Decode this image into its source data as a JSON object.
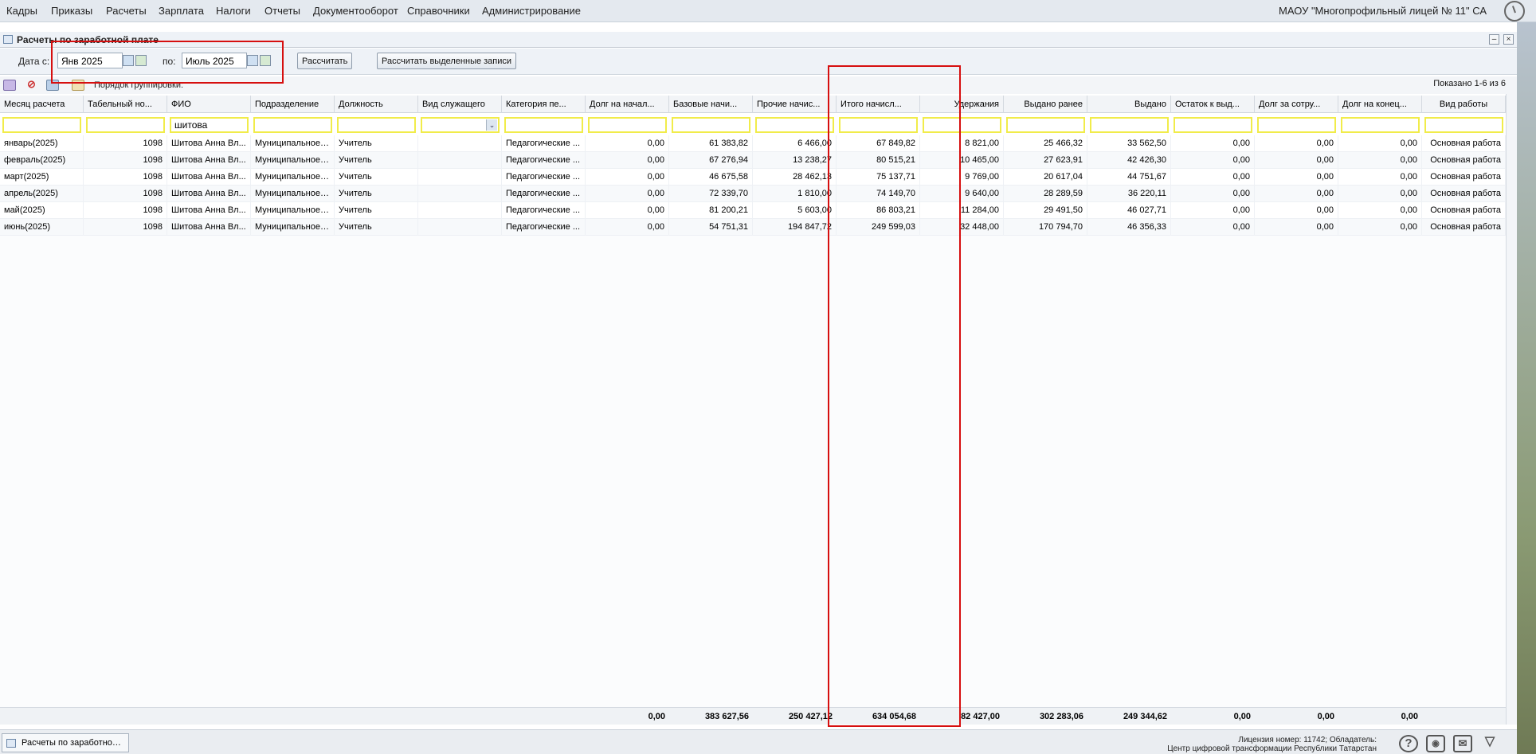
{
  "menu": [
    "Кадры",
    "Приказы",
    "Расчеты",
    "Зарплата",
    "Налоги",
    "Отчеты",
    "Документооборот",
    "Справочники",
    "Администрирование"
  ],
  "org_name": "МАОУ \"Многопрофильный лицей № 11\" СА",
  "window": {
    "title": "Расчеты по заработной плате"
  },
  "toolbar": {
    "date_from_label": "Дата с:",
    "date_from": "Янв 2025",
    "date_to_label": "по:",
    "date_to": "Июль 2025",
    "calc_button": "Рассчитать",
    "calc_selected_button": "Рассчитать выделенные записи"
  },
  "grid_toolbar": {
    "grouping_label": "Порядок группировки:",
    "shown": "Показано 1-6 из 6"
  },
  "columns": [
    "Месяц расчета",
    "Табельный но...",
    "ФИО",
    "Подразделение",
    "Должность",
    "Вид служащего",
    "Категория пе...",
    "Долг на начал...",
    "Базовые начи...",
    "Прочие начис...",
    "Итого начисл...",
    "Удержания",
    "Выдано ранее",
    "Выдано",
    "Остаток к выд...",
    "Долг за сотру...",
    "Долг на конец...",
    "Вид работы"
  ],
  "filters": {
    "fio": "шитова"
  },
  "rows": [
    [
      "январь(2025)",
      "1098",
      "Шитова Анна Вл...",
      "Муниципальное ...",
      "Учитель",
      "",
      "Педагогические ...",
      "0,00",
      "61 383,82",
      "6 466,00",
      "67 849,82",
      "8 821,00",
      "25 466,32",
      "33 562,50",
      "0,00",
      "0,00",
      "0,00",
      "Основная работа"
    ],
    [
      "февраль(2025)",
      "1098",
      "Шитова Анна Вл...",
      "Муниципальное ...",
      "Учитель",
      "",
      "Педагогические ...",
      "0,00",
      "67 276,94",
      "13 238,27",
      "80 515,21",
      "10 465,00",
      "27 623,91",
      "42 426,30",
      "0,00",
      "0,00",
      "0,00",
      "Основная работа"
    ],
    [
      "март(2025)",
      "1098",
      "Шитова Анна Вл...",
      "Муниципальное ...",
      "Учитель",
      "",
      "Педагогические ...",
      "0,00",
      "46 675,58",
      "28 462,13",
      "75 137,71",
      "9 769,00",
      "20 617,04",
      "44 751,67",
      "0,00",
      "0,00",
      "0,00",
      "Основная работа"
    ],
    [
      "апрель(2025)",
      "1098",
      "Шитова Анна Вл...",
      "Муниципальное ...",
      "Учитель",
      "",
      "Педагогические ...",
      "0,00",
      "72 339,70",
      "1 810,00",
      "74 149,70",
      "9 640,00",
      "28 289,59",
      "36 220,11",
      "0,00",
      "0,00",
      "0,00",
      "Основная работа"
    ],
    [
      "май(2025)",
      "1098",
      "Шитова Анна Вл...",
      "Муниципальное ...",
      "Учитель",
      "",
      "Педагогические ...",
      "0,00",
      "81 200,21",
      "5 603,00",
      "86 803,21",
      "11 284,00",
      "29 491,50",
      "46 027,71",
      "0,00",
      "0,00",
      "0,00",
      "Основная работа"
    ],
    [
      "июнь(2025)",
      "1098",
      "Шитова Анна Вл...",
      "Муниципальное ...",
      "Учитель",
      "",
      "Педагогические ...",
      "0,00",
      "54 751,31",
      "194 847,72",
      "249 599,03",
      "32 448,00",
      "170 794,70",
      "46 356,33",
      "0,00",
      "0,00",
      "0,00",
      "Основная работа"
    ]
  ],
  "totals": [
    "0,00",
    "383 627,56",
    "250 427,12",
    "634 054,68",
    "82 427,00",
    "302 283,06",
    "249 344,62",
    "0,00",
    "0,00",
    "0,00"
  ],
  "status": {
    "task": "Расчеты по заработной ...",
    "license_line1": "Лицензия номер: 11742; Обладатель:",
    "license_line2": "Центр цифровой трансформации Республики Татарстан"
  },
  "colors": {
    "highlight": "#d60f0f",
    "filter_border": "#f1ec4a"
  }
}
